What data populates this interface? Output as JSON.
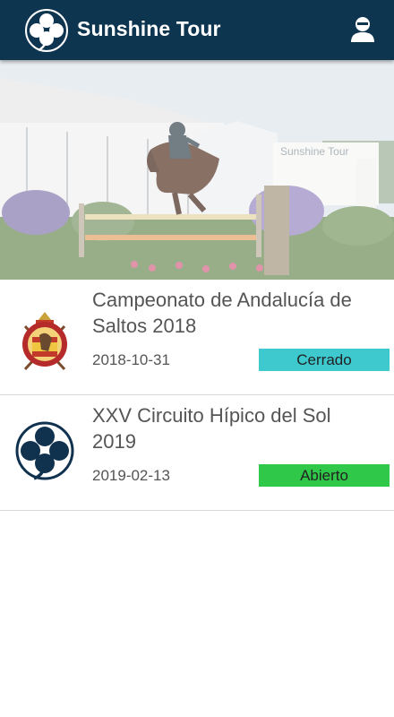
{
  "header": {
    "title": "Sunshine Tour",
    "logo_icon": "clover-logo-icon",
    "profile_icon": "user-profile-icon"
  },
  "hero": {
    "banner_text": "Sunshine Tour"
  },
  "events": [
    {
      "title": "Campeonato de Andalucía de Saltos 2018",
      "date": "2018-10-31",
      "status": "Cerrado",
      "logo_icon": "federation-crest-icon"
    },
    {
      "title": "XXV Circuito Hípico del Sol 2019",
      "date": "2019-02-13",
      "status": "Abierto",
      "logo_icon": "clover-logo-icon"
    }
  ],
  "colors": {
    "header_bg": "#0e3550",
    "status_closed": "#3ec9cf",
    "status_open": "#2fc848"
  }
}
